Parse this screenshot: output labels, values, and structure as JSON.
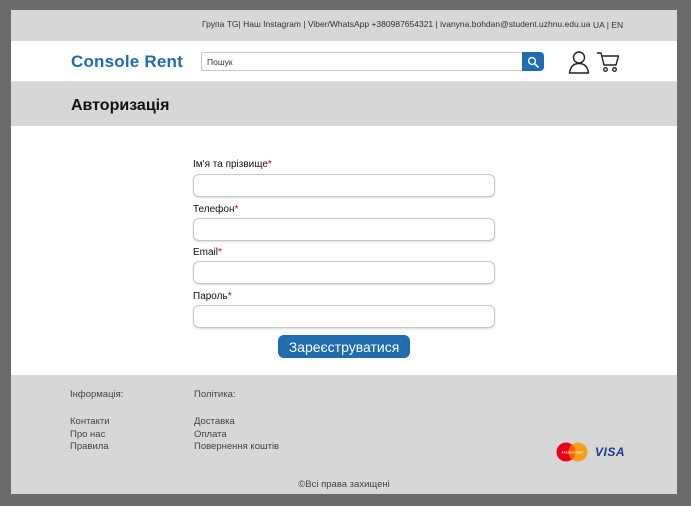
{
  "topbar": {
    "contacts": "Група TG| Наш Instagram | Viber/WhatsApp +380987654321 | ivanyna.bohdan@student.uzhnu.edu.ua",
    "lang_ua": "UA",
    "lang_sep": " | ",
    "lang_en": "EN"
  },
  "header": {
    "logo": "Console Rent",
    "search_value": "Пошук",
    "search_icon": "search-icon",
    "user_icon": "user-icon",
    "cart_icon": "cart-icon"
  },
  "page": {
    "title": "Авторизація"
  },
  "form": {
    "name_label": "Ім'я та прізвище",
    "phone_label": "Телефон",
    "email_label": "Email",
    "password_label": "Пароль",
    "required_mark": "*",
    "submit_label": "Зареєструватися"
  },
  "footer": {
    "info_heading": "Інформація:",
    "info_links": [
      "Контакти",
      "Про нас",
      "Правила"
    ],
    "policy_heading": "Політика:",
    "policy_links": [
      "Доставка",
      "Оплата",
      "Повернення коштів"
    ],
    "copyright": "©Всі права захищені",
    "mastercard_label": "MasterCard",
    "visa_label": "VISA"
  },
  "colors": {
    "brand": "#1f6cb0",
    "required": "#cc0000",
    "band": "#d7d7d7"
  }
}
